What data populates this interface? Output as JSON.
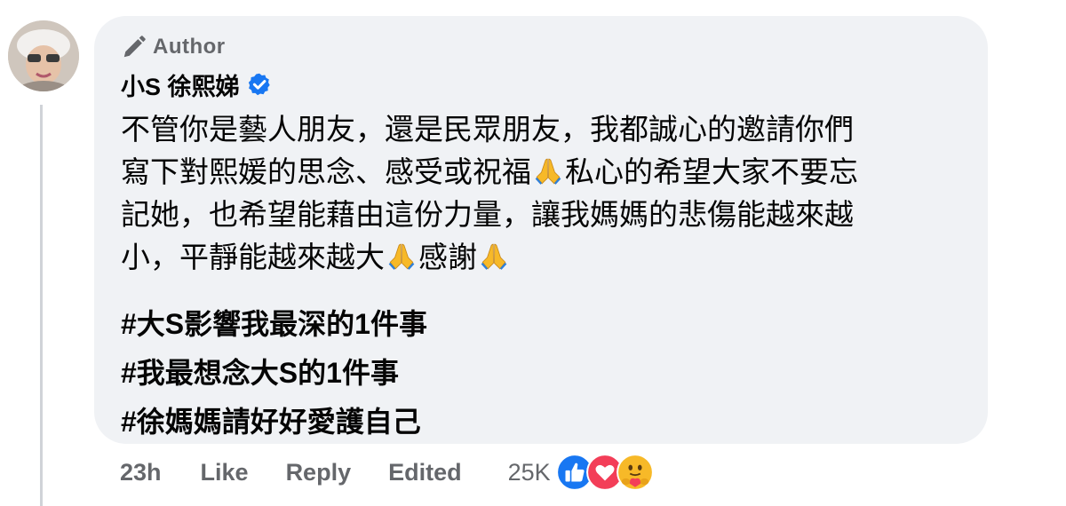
{
  "comment": {
    "author_badge": "Author",
    "author_name": "小S 徐熙娣",
    "body_lines": [
      "不管你是藝人朋友，還是民眾朋友，我都誠心的邀請你們",
      "寫下對熙媛的思念、感受或祝福",
      "私心的希望大家不要忘",
      "記她，也希望能藉由這份力量，讓我媽媽的悲傷能越來越",
      "小，平靜能越來越大",
      "感謝"
    ],
    "hashtags": [
      "#大S影響我最深的1件事",
      "#我最想念大S的1件事",
      "#徐媽媽請好好愛護自己"
    ]
  },
  "actions": {
    "timestamp": "23h",
    "like": "Like",
    "reply": "Reply",
    "edited": "Edited",
    "reaction_count": "25K"
  },
  "reactions": [
    "like-icon",
    "love-icon",
    "care-icon"
  ],
  "colors": {
    "bubble_bg": "#f0f2f5",
    "secondary_text": "#65676b",
    "verified_blue": "#1877f2",
    "like_blue": "#1877f2",
    "love_red": "#f33e58",
    "care_yellow": "#f7b928"
  }
}
